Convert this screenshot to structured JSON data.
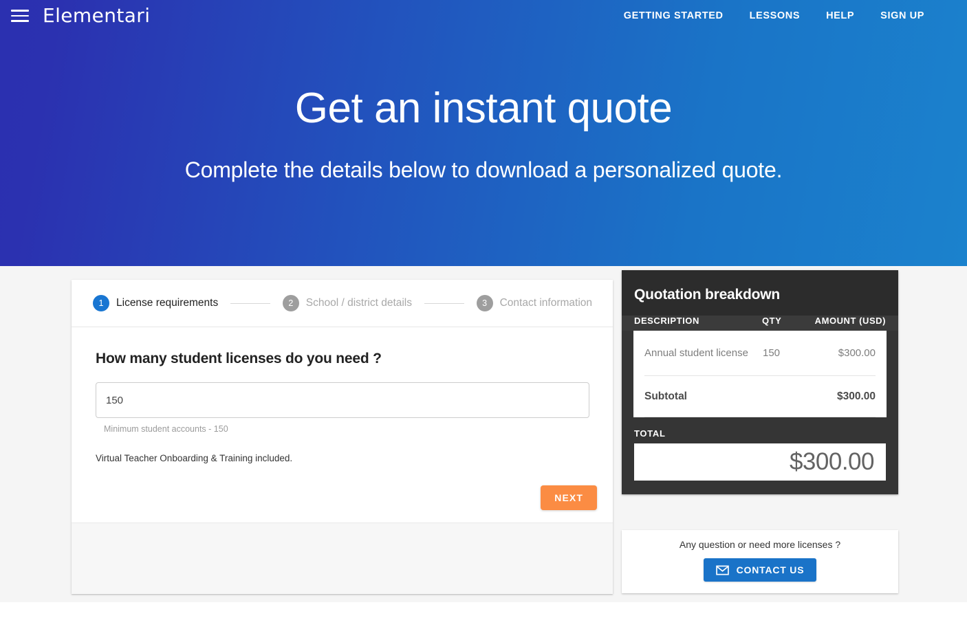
{
  "header": {
    "menu_icon": "hamburger-icon",
    "brand": "Elementari",
    "nav_links": [
      {
        "label": "GETTING STARTED"
      },
      {
        "label": "LESSONS"
      },
      {
        "label": "HELP"
      },
      {
        "label": "SIGN UP"
      }
    ]
  },
  "hero": {
    "title": "Get an instant quote",
    "subtitle": "Complete the details below to download a personalized quote.",
    "gradient_start": "#2b30b0",
    "gradient_end": "#1b82cd"
  },
  "stepper": {
    "steps": [
      {
        "number": "1",
        "label": "License requirements",
        "state": "active"
      },
      {
        "number": "2",
        "label": "School / district details",
        "state": "inactive"
      },
      {
        "number": "3",
        "label": "Contact information",
        "state": "inactive"
      }
    ],
    "active_color": "#1976d2",
    "inactive_color": "#9e9e9e"
  },
  "form": {
    "question": "How many student licenses do you need ?",
    "quantity_value": "150",
    "quantity_placeholder": "150",
    "hint": "Minimum student accounts - 150",
    "note": "Virtual Teacher Onboarding & Training included.",
    "next_label": "NEXT",
    "next_color": "#fb8c43"
  },
  "quote": {
    "title": "Quotation breakdown",
    "columns": {
      "description": "DESCRIPTION",
      "qty": "QTY",
      "amount": "AMOUNT (USD)"
    },
    "rows": [
      {
        "description": "Annual student license",
        "qty": "150",
        "amount": "$300.00"
      }
    ],
    "subtotal_label": "Subtotal",
    "subtotal_amount": "$300.00",
    "total_label": "TOTAL",
    "total_amount": "$300.00",
    "panel_color": "#353535"
  },
  "contact": {
    "prompt": "Any question or need more licenses ?",
    "button_label": "CONTACT US",
    "button_icon": "mail-icon",
    "button_color": "#1a73c8"
  }
}
